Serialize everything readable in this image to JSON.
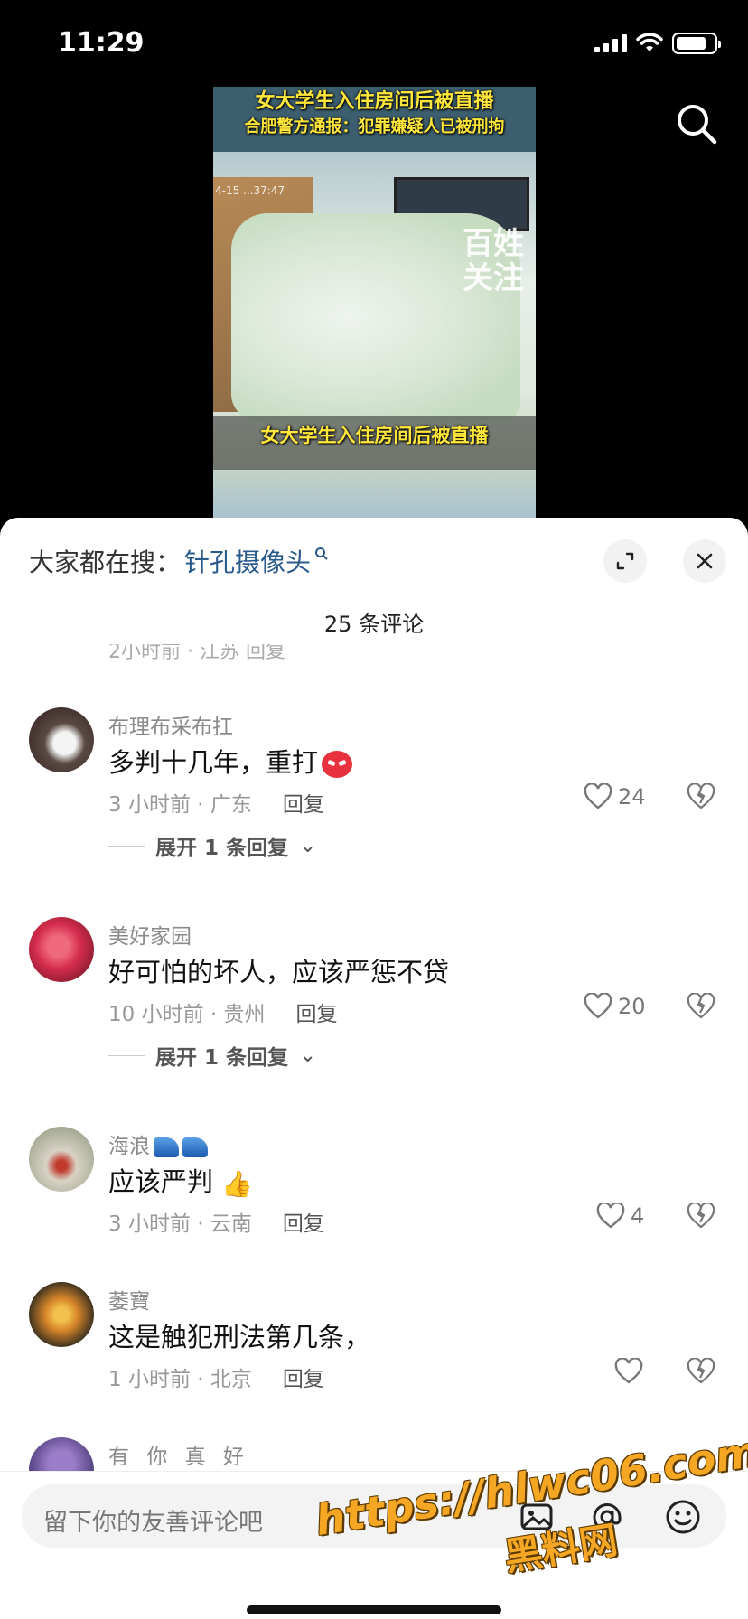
{
  "status_bar": {
    "time": "11:29",
    "battery_level": 0.8
  },
  "video": {
    "headline": "女大学生入住房间后被直播",
    "subheadline": "合肥警方通报：犯罪嫌疑人已被刑拘",
    "watermark": "百姓关注",
    "caption": "女大学生入住房间后被直播",
    "timestamp": "4-15 ...37:47"
  },
  "comments_panel": {
    "suggest_prefix": "大家都在搜：",
    "suggest_term": "针孔摄像头",
    "count_label": "25 条评论",
    "partial_meta": "2小时前 · 江苏    回复"
  },
  "comments": [
    {
      "username": "布理布采布扛",
      "text": "多判十几年，重打",
      "time": "3 小时前 · 广东",
      "reply": "回复",
      "likes": "24",
      "expand": "展开 1 条回复"
    },
    {
      "username": "美好家园",
      "text": "好可怕的坏人，应该严惩不贷",
      "time": "10 小时前 · 贵州",
      "reply": "回复",
      "likes": "20",
      "expand": "展开 1 条回复"
    },
    {
      "username": "海浪",
      "text": "应该严判",
      "time": "3 小时前 · 云南",
      "reply": "回复",
      "likes": "4"
    },
    {
      "username": "萎寶",
      "text": "这是触犯刑法第几条，",
      "time": "1 小时前 · 北京",
      "reply": "回复",
      "likes": ""
    },
    {
      "username": "有 你  真  好"
    }
  ],
  "input": {
    "placeholder": "留下你的友善评论吧"
  },
  "overlay_watermark": {
    "url": "https://hlwc06.com",
    "name": "黑料网"
  },
  "colors": {
    "accent_link": "#2a5a8c",
    "video_caption": "#ffe63a",
    "watermark": "#f5a623"
  }
}
